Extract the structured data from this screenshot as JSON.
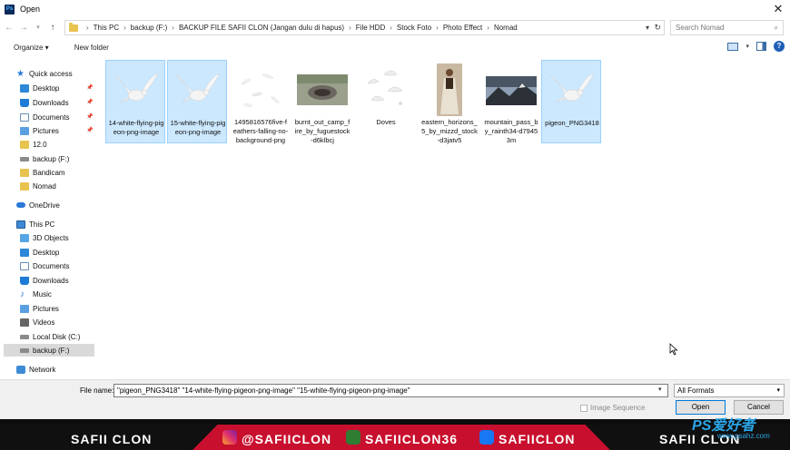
{
  "window": {
    "title": "Open",
    "app_icon_text": "Ps"
  },
  "address": {
    "crumbs": [
      "This PC",
      "backup (F:)",
      "BACKUP FILE SAFII CLON (Jangan dulu di hapus)",
      "File HDD",
      "Stock Foto",
      "Photo Effect",
      "Nomad"
    ],
    "search_placeholder": "Search Nomad"
  },
  "toolbar": {
    "organize": "Organize ▾",
    "new_folder": "New folder"
  },
  "nav": [
    {
      "label": "Quick access",
      "icon": "star-icon",
      "pinned": false
    },
    {
      "label": "Desktop",
      "icon": "desktop-icon",
      "pinned": true
    },
    {
      "label": "Downloads",
      "icon": "downloads-icon",
      "pinned": true
    },
    {
      "label": "Documents",
      "icon": "documents-icon",
      "pinned": true
    },
    {
      "label": "Pictures",
      "icon": "pictures-icon",
      "pinned": true
    },
    {
      "label": "12.0",
      "icon": "folder-icon",
      "pinned": false
    },
    {
      "label": "backup (F:)",
      "icon": "drive-icon",
      "pinned": false
    },
    {
      "label": "Bandicam",
      "icon": "folder-icon",
      "pinned": false
    },
    {
      "label": "Nomad",
      "icon": "folder-icon",
      "pinned": false
    },
    {
      "label": "OneDrive",
      "icon": "cloud-icon",
      "pinned": false
    },
    {
      "label": "This PC",
      "icon": "computer-icon",
      "pinned": false
    },
    {
      "label": "3D Objects",
      "icon": "3d-objects-icon",
      "pinned": false
    },
    {
      "label": "Desktop",
      "icon": "desktop-icon",
      "pinned": false
    },
    {
      "label": "Documents",
      "icon": "documents-icon",
      "pinned": false
    },
    {
      "label": "Downloads",
      "icon": "downloads-icon",
      "pinned": false
    },
    {
      "label": "Music",
      "icon": "music-icon",
      "pinned": false
    },
    {
      "label": "Pictures",
      "icon": "pictures-icon",
      "pinned": false
    },
    {
      "label": "Videos",
      "icon": "videos-icon",
      "pinned": false
    },
    {
      "label": "Local Disk (C:)",
      "icon": "drive-icon",
      "pinned": false
    },
    {
      "label": "backup (F:)",
      "icon": "drive-icon",
      "pinned": false,
      "selected": true
    },
    {
      "label": "Network",
      "icon": "network-icon",
      "pinned": false
    }
  ],
  "files": [
    {
      "name": "14-white-flying-pigeon-png-image",
      "selected": true,
      "thumb": "pigeon"
    },
    {
      "name": "15-white-flying-pigeon-png-image",
      "selected": true,
      "thumb": "pigeon"
    },
    {
      "name": "1495816576five-feathers-falling-no-background-png",
      "selected": false,
      "thumb": "feathers"
    },
    {
      "name": "burnt_out_camp_fire_by_fuguestock-d6klbcj",
      "selected": false,
      "thumb": "campfire"
    },
    {
      "name": "Doves",
      "selected": false,
      "thumb": "doves"
    },
    {
      "name": "eastern_horizons_5_by_mizzd_stock-d3jatv5",
      "selected": false,
      "thumb": "person"
    },
    {
      "name": "mountain_pass_by_rainth34-d79453m",
      "selected": false,
      "thumb": "mountain"
    },
    {
      "name": "pigeon_PNG3418",
      "selected": true,
      "thumb": "pigeon"
    }
  ],
  "footer": {
    "file_name_label": "File name:",
    "file_name_value": "\"pigeon_PNG3418\" \"14-white-flying-pigeon-png-image\" \"15-white-flying-pigeon-png-image\"",
    "format": "All Formats",
    "image_sequence": "Image Sequence",
    "open": "Open",
    "cancel": "Cancel"
  },
  "banner": {
    "left": "SAFII CLON",
    "instagram": "@SAFIICLON",
    "download": "SAFIICLON36",
    "facebook": "SAFIICLON",
    "right": "SAFII CLON"
  },
  "watermark": {
    "main": "PS爱好者",
    "sub": "www.psahz.com"
  }
}
